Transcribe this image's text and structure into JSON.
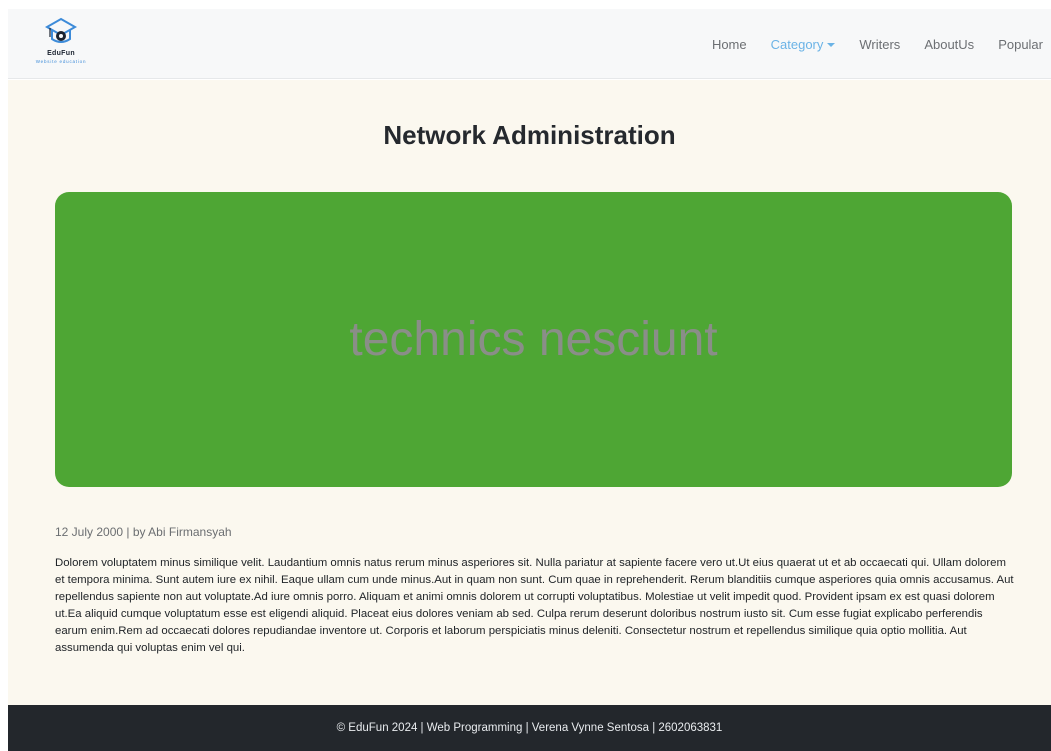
{
  "brand": {
    "name": "EduFun",
    "tagline": "Website education",
    "accent": "#3d8bd9"
  },
  "nav": {
    "items": [
      {
        "label": "Home",
        "active": false
      },
      {
        "label": "Category",
        "active": true,
        "dropdown": true
      },
      {
        "label": "Writers",
        "active": false
      },
      {
        "label": "AboutUs",
        "active": false
      },
      {
        "label": "Popular",
        "active": false
      }
    ]
  },
  "article": {
    "title": "Network Administration",
    "image_text": "technics nesciunt",
    "image_bg_color": "#4ea634",
    "meta": "12 July 2000 | by Abi Firmansyah",
    "body": "Dolorem voluptatem minus similique velit. Laudantium omnis natus rerum minus asperiores sit. Nulla pariatur at sapiente facere vero ut.Ut eius quaerat ut et ab occaecati qui. Ullam dolorem et tempora minima. Sunt autem iure ex nihil. Eaque ullam cum unde minus.Aut in quam non sunt. Cum quae in reprehenderit. Rerum blanditiis cumque asperiores quia omnis accusamus. Aut repellendus sapiente non aut voluptate.Ad iure omnis porro. Aliquam et animi omnis dolorem ut corrupti voluptatibus. Molestiae ut velit impedit quod. Provident ipsam ex est quasi dolorem ut.Ea aliquid cumque voluptatum esse est eligendi aliquid. Placeat eius dolores veniam ab sed. Culpa rerum deserunt doloribus nostrum iusto sit. Cum esse fugiat explicabo perferendis earum enim.Rem ad occaecati dolores repudiandae inventore ut. Corporis et laborum perspiciatis minus deleniti. Consectetur nostrum et repellendus similique quia optio mollitia. Aut assumenda qui voluptas enim vel qui."
  },
  "footer": {
    "text": "© EduFun 2024 | Web Programming | Verena Vynne Sentosa | 2602063831"
  }
}
